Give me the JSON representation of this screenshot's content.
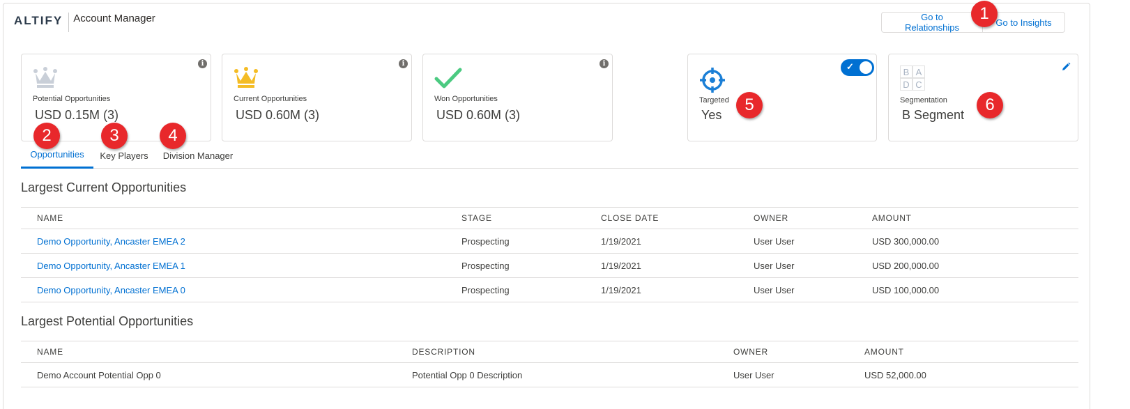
{
  "app": {
    "logo": "ALTIFY",
    "title": "Account Manager"
  },
  "header_buttons": {
    "relationships": "Go to Relationships",
    "insights": "Go to Insights"
  },
  "cards": [
    {
      "label": "Potential Opportunities",
      "value": "USD 0.15M (3)",
      "icon": "crown-icon-grey",
      "info": "i"
    },
    {
      "label": "Current Opportunities",
      "value": "USD 0.60M (3)",
      "icon": "crown-icon-gold",
      "info": "i"
    },
    {
      "label": "Won Opportunities",
      "value": "USD 0.60M (3)",
      "icon": "checkmark-icon",
      "info": "i"
    },
    {
      "label": "Targeted",
      "value": "Yes",
      "icon": "target-icon",
      "toggle_on": true
    },
    {
      "label": "Segmentation",
      "value": "B Segment",
      "icon": "segmentation-grid-icon",
      "grid": [
        "B",
        "A",
        "D",
        "C"
      ]
    }
  ],
  "tabs": [
    {
      "label": "Opportunities",
      "active": true
    },
    {
      "label": "Key Players",
      "active": false
    },
    {
      "label": "Division Manager",
      "active": false
    }
  ],
  "current_section": {
    "title": "Largest Current Opportunities",
    "columns": [
      "NAME",
      "STAGE",
      "CLOSE DATE",
      "OWNER",
      "AMOUNT"
    ],
    "rows": [
      [
        "Demo Opportunity, Ancaster EMEA 2",
        "Prospecting",
        "1/19/2021",
        "User User",
        "USD 300,000.00"
      ],
      [
        "Demo Opportunity, Ancaster EMEA 1",
        "Prospecting",
        "1/19/2021",
        "User User",
        "USD 200,000.00"
      ],
      [
        "Demo Opportunity, Ancaster EMEA 0",
        "Prospecting",
        "1/19/2021",
        "User User",
        "USD 100,000.00"
      ]
    ]
  },
  "potential_section": {
    "title": "Largest Potential Opportunities",
    "columns": [
      "NAME",
      "DESCRIPTION",
      "OWNER",
      "AMOUNT"
    ],
    "rows": [
      [
        "Demo Account Potential Opp 0",
        "Potential Opp 0 Description",
        "User User",
        "USD 52,000.00"
      ]
    ]
  },
  "markers": [
    "1",
    "2",
    "3",
    "4",
    "5",
    "6"
  ],
  "colors": {
    "accent": "#0070d2",
    "marker": "#e8282b",
    "gold": "#f4bc25",
    "green": "#4bca81",
    "grey_crown": "#c9cfd8",
    "target": "#1b7fd6"
  }
}
